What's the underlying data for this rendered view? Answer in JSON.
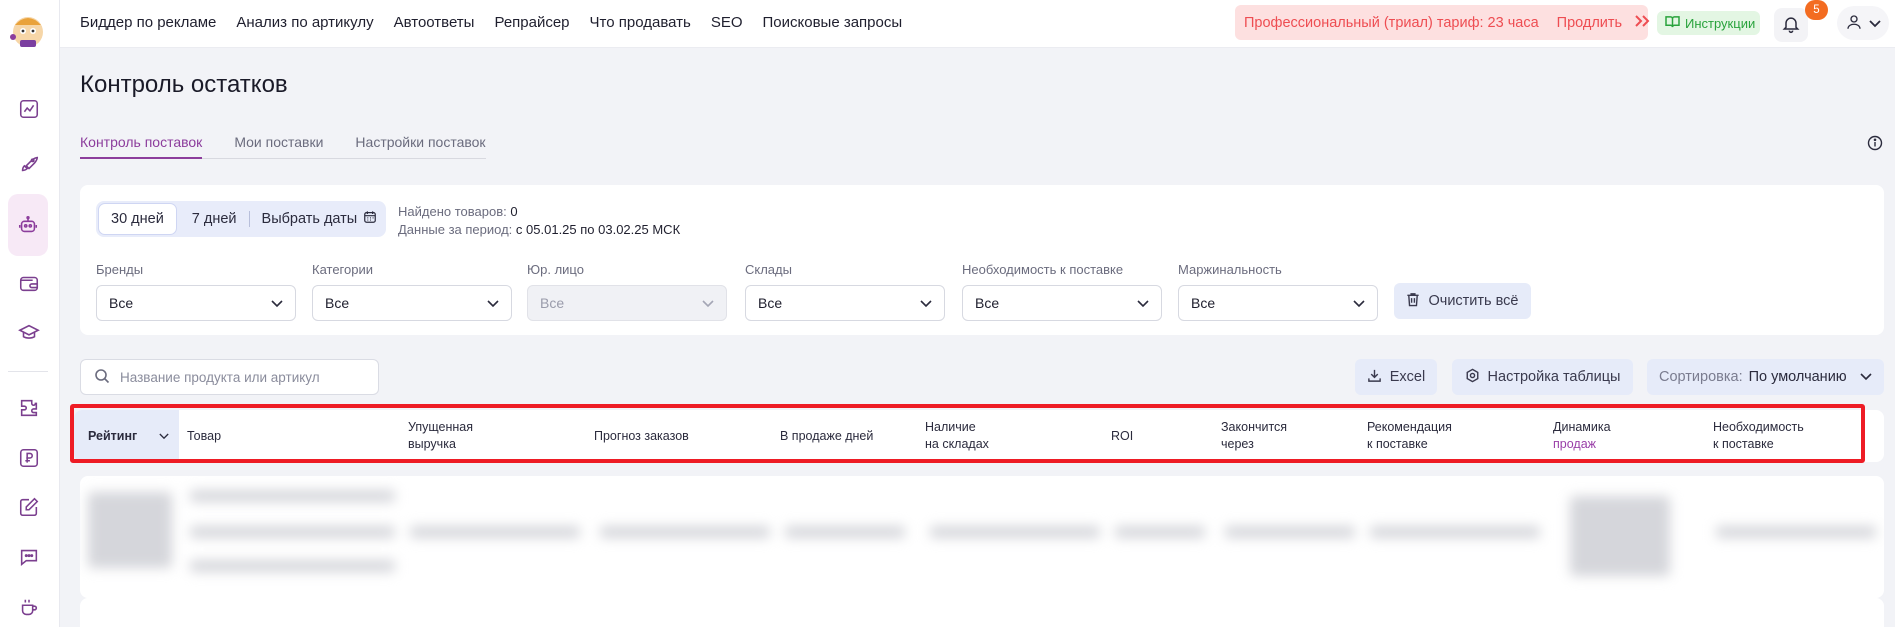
{
  "nav": {
    "items": [
      "Биддер по рекламе",
      "Анализ по артикулу",
      "Автоответы",
      "Репрайсер",
      "Что продавать",
      "SEO",
      "Поисковые запросы"
    ],
    "trial_text": "Профессиональный (триал) тариф: 23 часа",
    "trial_link": "Продлить",
    "instructions": "Инструкции",
    "notifications_count": "5"
  },
  "sidebar": {
    "icons": [
      "chart-line-icon",
      "rocket-icon",
      "robot-icon",
      "wallet-icon",
      "graduation-cap-icon",
      "puzzle-icon",
      "ruble-icon",
      "edit-icon",
      "chat-icon",
      "coffee-icon"
    ],
    "active": "robot-icon"
  },
  "page": {
    "title": "Контроль остатков",
    "tabs": [
      "Контроль поставок",
      "Мои поставки",
      "Настройки поставок"
    ],
    "active_tab": 0
  },
  "period": {
    "options": [
      "30 дней",
      "7 дней",
      "Выбрать даты"
    ],
    "active": 0,
    "found_label": "Найдено товаров:",
    "found_value": "0",
    "range_label": "Данные за период:",
    "range_value": "с 05.01.25 по 03.02.25 МСК"
  },
  "filters": [
    {
      "label": "Бренды",
      "value": "Все",
      "disabled": false
    },
    {
      "label": "Категории",
      "value": "Все",
      "disabled": false
    },
    {
      "label": "Юр. лицо",
      "value": "Все",
      "disabled": true
    },
    {
      "label": "Склады",
      "value": "Все",
      "disabled": false
    },
    {
      "label": "Необходимость к поставке",
      "value": "Все",
      "disabled": false
    },
    {
      "label": "Маржинальность",
      "value": "Все",
      "disabled": false
    }
  ],
  "clear_all": "Очистить всё",
  "toolbar": {
    "search_placeholder": "Название продукта или артикул",
    "excel": "Excel",
    "table_settings": "Настройка таблицы",
    "sort_label": "Сортировка:",
    "sort_value": "По умолчанию"
  },
  "table": {
    "headers": {
      "rating": "Рейтинг",
      "product": "Товар",
      "lost_revenue_1": "Упущенная",
      "lost_revenue_2": "выручка",
      "forecast": "Прогноз заказов",
      "days_on_sale": "В продаже дней",
      "stock_1": "Наличие",
      "stock_2": "на складах",
      "roi": "ROI",
      "runs_out_1": "Закончится",
      "runs_out_2": "через",
      "recommendation_1": "Рекомендация",
      "recommendation_2": "к поставке",
      "dynamics_1": "Динамика",
      "dynamics_2": "продаж",
      "need_1": "Необходимость",
      "need_2": "к поставке"
    }
  }
}
